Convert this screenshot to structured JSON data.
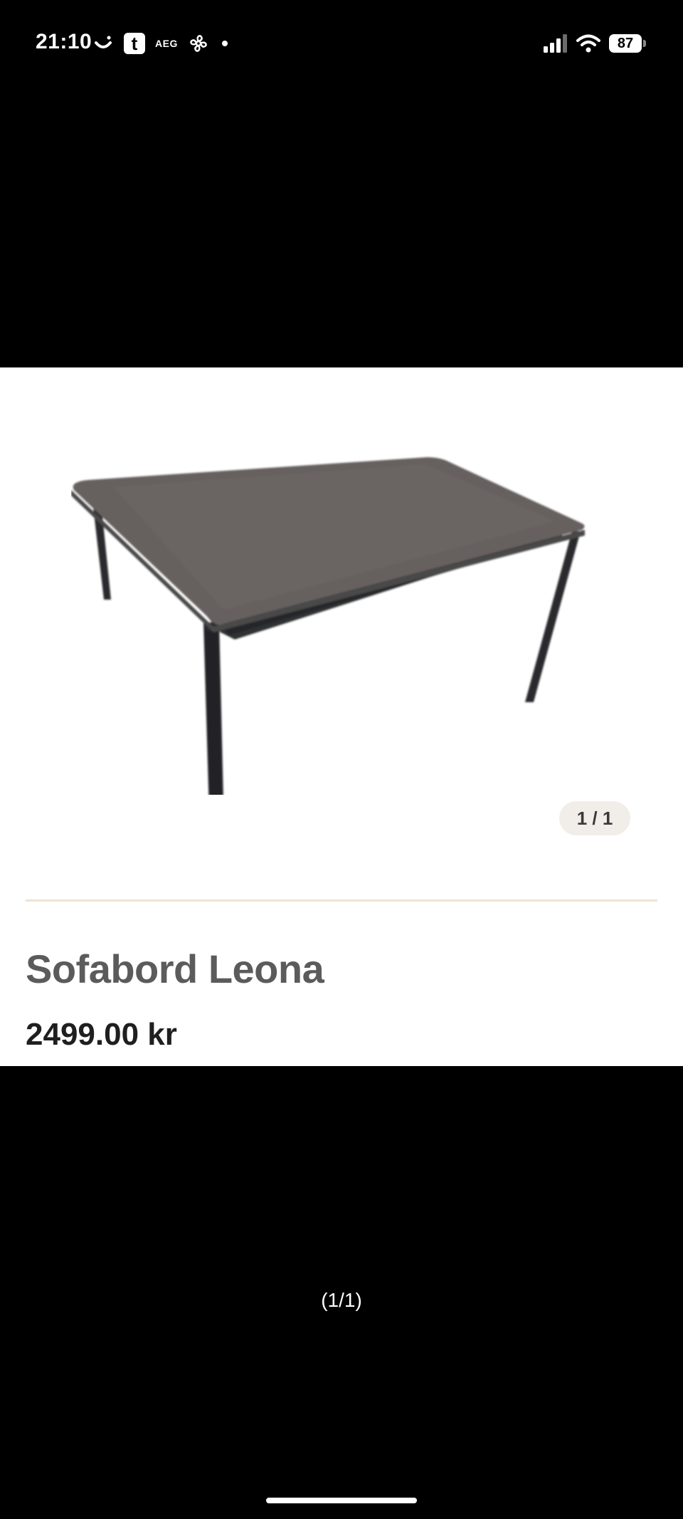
{
  "status_bar": {
    "time": "21:10",
    "aeg_label": "AEG",
    "t_app_label": "t",
    "battery_level": "87",
    "icons": [
      "smile-icon",
      "t-app-icon",
      "aeg-icon",
      "fan-icon",
      "dot-icon",
      "signal-icon",
      "wifi-icon",
      "battery-icon"
    ]
  },
  "product": {
    "image_counter": "1 / 1",
    "title": "Sofabord Leona",
    "price": "2499.00 kr"
  },
  "viewer": {
    "page_indicator": "(1/1)"
  },
  "colors": {
    "background": "#000000",
    "card": "#ffffff",
    "divider": "#eee3d6",
    "counter_bg": "#f1eeea",
    "title": "#5b5b5b",
    "price": "#1f1f1f"
  }
}
